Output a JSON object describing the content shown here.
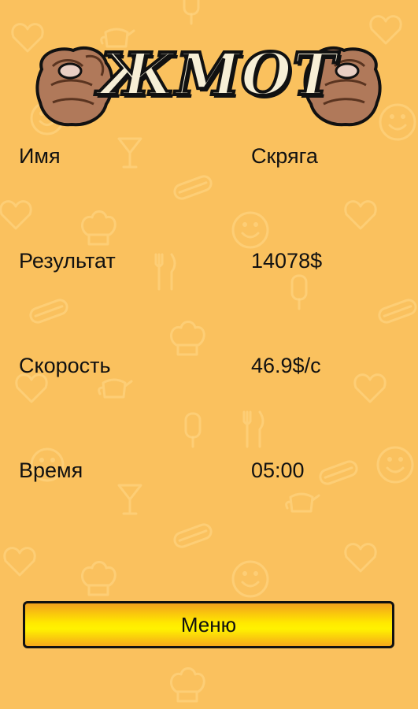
{
  "header": {
    "logo_text": "ЖМОТ"
  },
  "stats": {
    "name_label": "Имя",
    "name_value": "Скряга",
    "score_label": "Результат",
    "score_value": "14078$",
    "speed_label": "Скорость",
    "speed_value": "46.9$/с",
    "time_label": "Время",
    "time_value": "05:00"
  },
  "menu": {
    "button_label": "Меню"
  },
  "colors": {
    "background": "#FAC15E",
    "pattern": "#FFD88A",
    "button_yellow": "#FFF200",
    "button_orange": "#F3A21C",
    "text": "#111111"
  },
  "icons": [
    "heart-icon",
    "smiley-icon",
    "hotdog-icon",
    "cocktail-icon",
    "chef-hat-icon",
    "teapot-icon",
    "cutlery-icon",
    "popsicle-icon",
    "fist-icon"
  ]
}
